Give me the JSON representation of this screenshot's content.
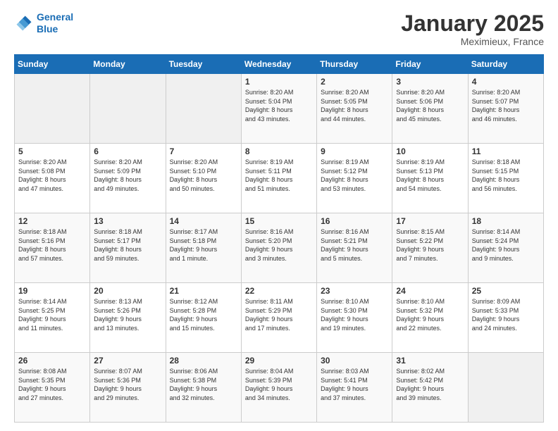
{
  "header": {
    "logo_line1": "General",
    "logo_line2": "Blue",
    "month": "January 2025",
    "location": "Meximieux, France"
  },
  "weekdays": [
    "Sunday",
    "Monday",
    "Tuesday",
    "Wednesday",
    "Thursday",
    "Friday",
    "Saturday"
  ],
  "weeks": [
    [
      {
        "day": "",
        "info": ""
      },
      {
        "day": "",
        "info": ""
      },
      {
        "day": "",
        "info": ""
      },
      {
        "day": "1",
        "info": "Sunrise: 8:20 AM\nSunset: 5:04 PM\nDaylight: 8 hours\nand 43 minutes."
      },
      {
        "day": "2",
        "info": "Sunrise: 8:20 AM\nSunset: 5:05 PM\nDaylight: 8 hours\nand 44 minutes."
      },
      {
        "day": "3",
        "info": "Sunrise: 8:20 AM\nSunset: 5:06 PM\nDaylight: 8 hours\nand 45 minutes."
      },
      {
        "day": "4",
        "info": "Sunrise: 8:20 AM\nSunset: 5:07 PM\nDaylight: 8 hours\nand 46 minutes."
      }
    ],
    [
      {
        "day": "5",
        "info": "Sunrise: 8:20 AM\nSunset: 5:08 PM\nDaylight: 8 hours\nand 47 minutes."
      },
      {
        "day": "6",
        "info": "Sunrise: 8:20 AM\nSunset: 5:09 PM\nDaylight: 8 hours\nand 49 minutes."
      },
      {
        "day": "7",
        "info": "Sunrise: 8:20 AM\nSunset: 5:10 PM\nDaylight: 8 hours\nand 50 minutes."
      },
      {
        "day": "8",
        "info": "Sunrise: 8:19 AM\nSunset: 5:11 PM\nDaylight: 8 hours\nand 51 minutes."
      },
      {
        "day": "9",
        "info": "Sunrise: 8:19 AM\nSunset: 5:12 PM\nDaylight: 8 hours\nand 53 minutes."
      },
      {
        "day": "10",
        "info": "Sunrise: 8:19 AM\nSunset: 5:13 PM\nDaylight: 8 hours\nand 54 minutes."
      },
      {
        "day": "11",
        "info": "Sunrise: 8:18 AM\nSunset: 5:15 PM\nDaylight: 8 hours\nand 56 minutes."
      }
    ],
    [
      {
        "day": "12",
        "info": "Sunrise: 8:18 AM\nSunset: 5:16 PM\nDaylight: 8 hours\nand 57 minutes."
      },
      {
        "day": "13",
        "info": "Sunrise: 8:18 AM\nSunset: 5:17 PM\nDaylight: 8 hours\nand 59 minutes."
      },
      {
        "day": "14",
        "info": "Sunrise: 8:17 AM\nSunset: 5:18 PM\nDaylight: 9 hours\nand 1 minute."
      },
      {
        "day": "15",
        "info": "Sunrise: 8:16 AM\nSunset: 5:20 PM\nDaylight: 9 hours\nand 3 minutes."
      },
      {
        "day": "16",
        "info": "Sunrise: 8:16 AM\nSunset: 5:21 PM\nDaylight: 9 hours\nand 5 minutes."
      },
      {
        "day": "17",
        "info": "Sunrise: 8:15 AM\nSunset: 5:22 PM\nDaylight: 9 hours\nand 7 minutes."
      },
      {
        "day": "18",
        "info": "Sunrise: 8:14 AM\nSunset: 5:24 PM\nDaylight: 9 hours\nand 9 minutes."
      }
    ],
    [
      {
        "day": "19",
        "info": "Sunrise: 8:14 AM\nSunset: 5:25 PM\nDaylight: 9 hours\nand 11 minutes."
      },
      {
        "day": "20",
        "info": "Sunrise: 8:13 AM\nSunset: 5:26 PM\nDaylight: 9 hours\nand 13 minutes."
      },
      {
        "day": "21",
        "info": "Sunrise: 8:12 AM\nSunset: 5:28 PM\nDaylight: 9 hours\nand 15 minutes."
      },
      {
        "day": "22",
        "info": "Sunrise: 8:11 AM\nSunset: 5:29 PM\nDaylight: 9 hours\nand 17 minutes."
      },
      {
        "day": "23",
        "info": "Sunrise: 8:10 AM\nSunset: 5:30 PM\nDaylight: 9 hours\nand 19 minutes."
      },
      {
        "day": "24",
        "info": "Sunrise: 8:10 AM\nSunset: 5:32 PM\nDaylight: 9 hours\nand 22 minutes."
      },
      {
        "day": "25",
        "info": "Sunrise: 8:09 AM\nSunset: 5:33 PM\nDaylight: 9 hours\nand 24 minutes."
      }
    ],
    [
      {
        "day": "26",
        "info": "Sunrise: 8:08 AM\nSunset: 5:35 PM\nDaylight: 9 hours\nand 27 minutes."
      },
      {
        "day": "27",
        "info": "Sunrise: 8:07 AM\nSunset: 5:36 PM\nDaylight: 9 hours\nand 29 minutes."
      },
      {
        "day": "28",
        "info": "Sunrise: 8:06 AM\nSunset: 5:38 PM\nDaylight: 9 hours\nand 32 minutes."
      },
      {
        "day": "29",
        "info": "Sunrise: 8:04 AM\nSunset: 5:39 PM\nDaylight: 9 hours\nand 34 minutes."
      },
      {
        "day": "30",
        "info": "Sunrise: 8:03 AM\nSunset: 5:41 PM\nDaylight: 9 hours\nand 37 minutes."
      },
      {
        "day": "31",
        "info": "Sunrise: 8:02 AM\nSunset: 5:42 PM\nDaylight: 9 hours\nand 39 minutes."
      },
      {
        "day": "",
        "info": ""
      }
    ]
  ]
}
